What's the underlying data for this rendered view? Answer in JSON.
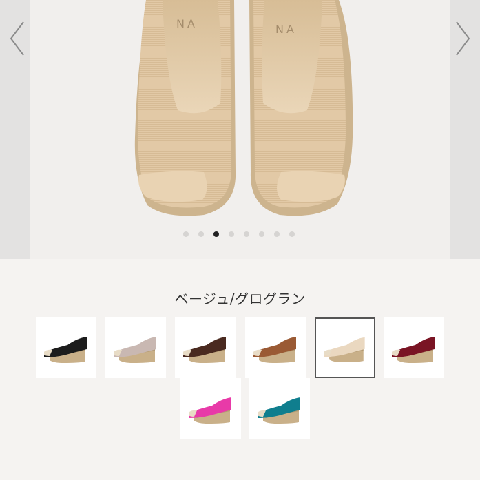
{
  "gallery": {
    "total_slides": 8,
    "active_index": 2,
    "brand_text_fragment": "NA"
  },
  "color_selector": {
    "selected_label": "ベージュ/グログラン",
    "swatches": [
      {
        "color": "#1c1c1c",
        "selected": false
      },
      {
        "color": "#c9b8b2",
        "selected": false
      },
      {
        "color": "#4a2a20",
        "selected": false
      },
      {
        "color": "#9a5a34",
        "selected": false
      },
      {
        "color": "#ead8c0",
        "selected": true
      },
      {
        "color": "#7a1424",
        "selected": false
      },
      {
        "color": "#e83aa8",
        "selected": false
      },
      {
        "color": "#0f7e8e",
        "selected": false
      }
    ]
  }
}
